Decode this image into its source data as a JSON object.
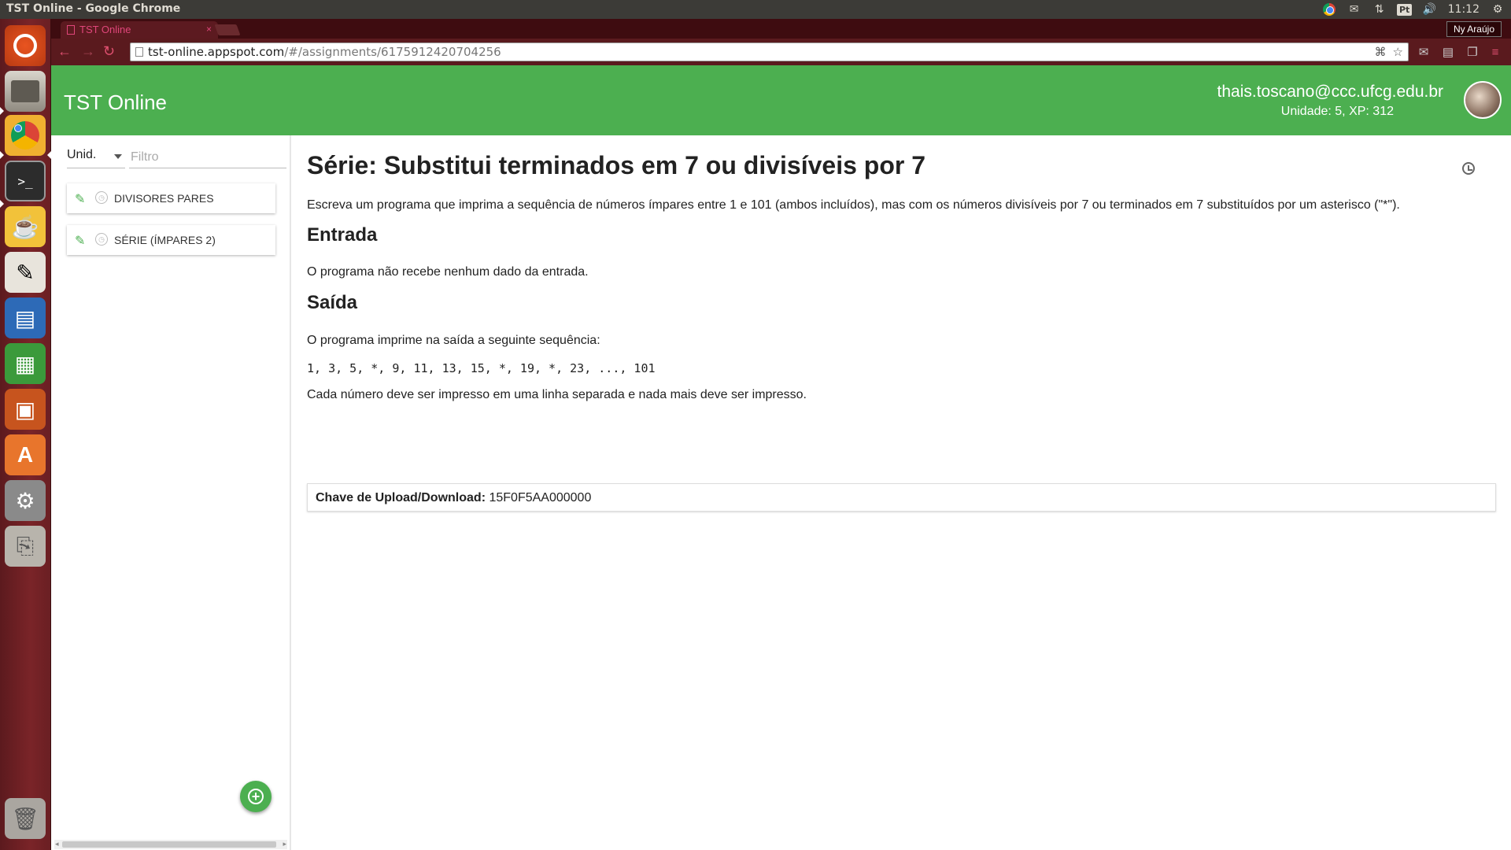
{
  "window_title": "TST Online - Google Chrome",
  "tray": {
    "lang": "Pt",
    "time": "11:12"
  },
  "browser": {
    "tab_title": "TST Online",
    "profile_name": "Ny Araújo",
    "url_host": "tst-online.appspot.com",
    "url_path": "/#/assignments/6175912420704256"
  },
  "app": {
    "title": "TST Online",
    "user_email": "thais.toscano@ccc.ufcg.edu.br",
    "user_stats": "Unidade: 5, XP: 312"
  },
  "sidebar": {
    "unit_select": "Unid.",
    "filter_placeholder": "Filtro",
    "items": [
      {
        "label": "DIVISORES PARES"
      },
      {
        "label": "SÉRIE (ÍMPARES 2)"
      }
    ]
  },
  "content": {
    "title": "Série: Substitui terminados em 7 ou divisíveis por 7",
    "description": "Escreva um programa que imprima a sequência de números ímpares entre 1 e 101 (ambos incluídos), mas com os números divisíveis por 7 ou terminados em 7 substituídos por um asterisco (\"*\").",
    "input_heading": "Entrada",
    "input_text": "O programa não recebe nenhum dado da entrada.",
    "output_heading": "Saída",
    "output_text": "O programa imprime na saída a seguinte sequência:",
    "output_sequence": "1, 3, 5, *, 9, 11, 13, 15, *, 19, *, 23, ..., 101",
    "output_note": "Cada número deve ser impresso em uma linha separada e nada mais deve ser impresso.",
    "key_label": "Chave de Upload/Download:",
    "key_value": "15F0F5AA000000"
  },
  "colors": {
    "header_green": "#4caf50",
    "launcher": "#7a2428",
    "chrome_frame": "#5a1a1e"
  }
}
